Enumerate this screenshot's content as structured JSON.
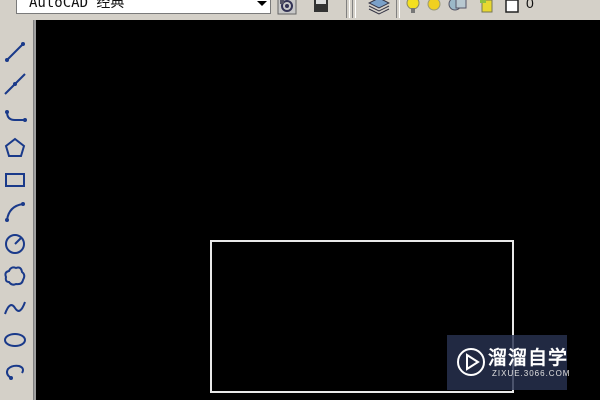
{
  "toolbar": {
    "workspace": "AutoCAD 经典",
    "layer": "0"
  },
  "draw_tools": [
    {
      "icon": "line-icon"
    },
    {
      "icon": "construction-line-icon"
    },
    {
      "icon": "polyline-icon"
    },
    {
      "icon": "polygon-icon"
    },
    {
      "icon": "rectangle-icon"
    },
    {
      "icon": "arc-icon"
    },
    {
      "icon": "circle-icon"
    },
    {
      "icon": "revision-cloud-icon"
    },
    {
      "icon": "spline-icon"
    },
    {
      "icon": "ellipse-icon"
    },
    {
      "icon": "ellipse-arc-icon"
    }
  ],
  "watermark": {
    "title": "溜溜自学",
    "url": "ZIXUE.3066.COM"
  },
  "colors": {
    "canvas": "#000000",
    "toolbar": "#d4d0c8",
    "tool_icon": "#1a3a8a"
  }
}
